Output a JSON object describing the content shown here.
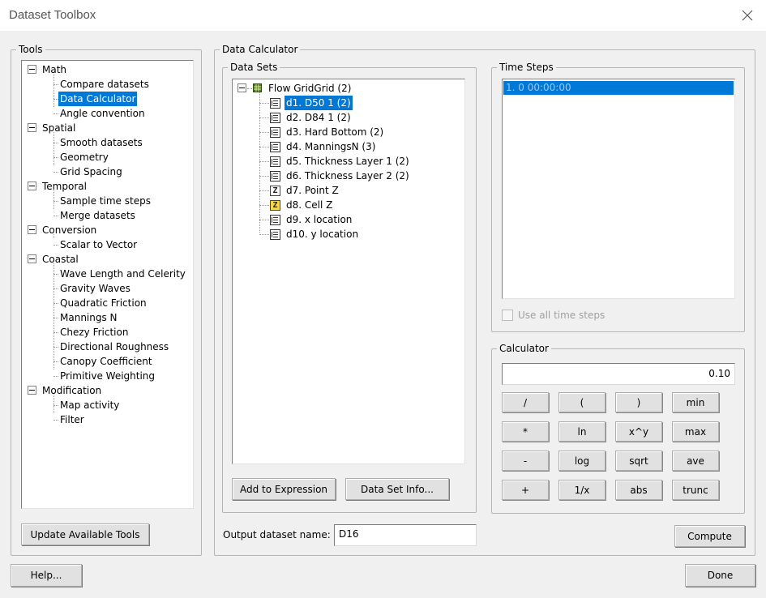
{
  "window": {
    "title": "Dataset Toolbox"
  },
  "tools": {
    "legend": "Tools",
    "categories": [
      {
        "label": "Math",
        "items": [
          "Compare datasets",
          "Data Calculator",
          "Angle convention"
        ]
      },
      {
        "label": "Spatial",
        "items": [
          "Smooth datasets",
          "Geometry",
          "Grid Spacing"
        ]
      },
      {
        "label": "Temporal",
        "items": [
          "Sample time steps",
          "Merge datasets"
        ]
      },
      {
        "label": "Conversion",
        "items": [
          "Scalar to Vector"
        ]
      },
      {
        "label": "Coastal",
        "items": [
          "Wave Length and Celerity",
          "Gravity Waves",
          "Quadratic Friction",
          "Mannings N",
          "Chezy Friction",
          "Directional Roughness",
          "Canopy Coefficient",
          "Primitive Weighting"
        ]
      },
      {
        "label": "Modification",
        "items": [
          "Map activity",
          "Filter"
        ]
      }
    ],
    "update_button": "Update Available Tools"
  },
  "calculator_panel": {
    "legend": "Data Calculator",
    "datasets": {
      "legend": "Data Sets",
      "root": "Flow GridGrid (2)",
      "items": [
        {
          "label": "d1. D50 1 (2)",
          "icon": "grid-dataset-icon"
        },
        {
          "label": "d2. D84 1 (2)",
          "icon": "grid-dataset-icon"
        },
        {
          "label": "d3. Hard Bottom (2)",
          "icon": "grid-dataset-icon"
        },
        {
          "label": "d4. ManningsN (3)",
          "icon": "grid-dataset-icon"
        },
        {
          "label": "d5. Thickness Layer 1 (2)",
          "icon": "grid-dataset-icon"
        },
        {
          "label": "d6. Thickness Layer 2 (2)",
          "icon": "grid-dataset-icon"
        },
        {
          "label": "d7. Point Z",
          "icon": "z-point-icon"
        },
        {
          "label": "d8. Cell Z",
          "icon": "z-cell-icon"
        },
        {
          "label": "d9. x location",
          "icon": "grid-dataset-icon"
        },
        {
          "label": "d10. y location",
          "icon": "grid-dataset-icon"
        }
      ],
      "add_button": "Add to Expression",
      "info_button": "Data Set Info..."
    },
    "time_steps": {
      "legend": "Time Steps",
      "items": [
        "1. 0 00:00:00"
      ],
      "use_all_label": "Use all time steps",
      "use_all_checked": false
    },
    "calculator": {
      "legend": "Calculator",
      "expression": "0.10",
      "keys": [
        [
          "/",
          "(",
          ")",
          "min"
        ],
        [
          "*",
          "ln",
          "x^y",
          "max"
        ],
        [
          "-",
          "log",
          "sqrt",
          "ave"
        ],
        [
          "+",
          "1/x",
          "abs",
          "trunc"
        ]
      ]
    },
    "output_label": "Output dataset name:",
    "output_value": "D16",
    "compute_button": "Compute"
  },
  "footer": {
    "help_button": "Help...",
    "done_button": "Done"
  },
  "colors": {
    "selection": "#0078d7",
    "background": "#f0f0f0"
  }
}
